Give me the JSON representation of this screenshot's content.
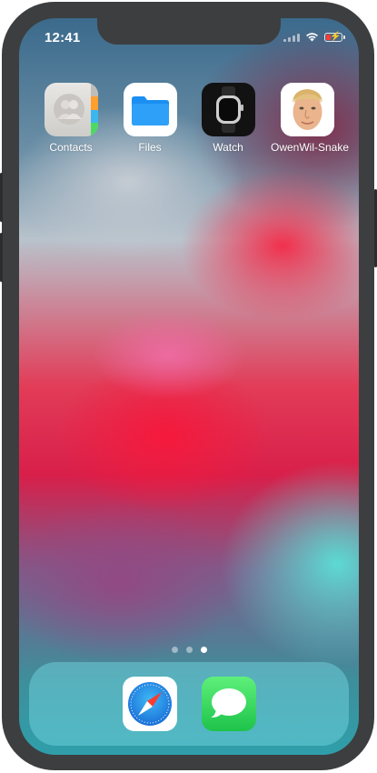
{
  "status_bar": {
    "time": "12:41",
    "battery_level": 0.3,
    "charging": true
  },
  "home_screen": {
    "apps": [
      {
        "label": "Contacts",
        "icon": "contacts-icon"
      },
      {
        "label": "Files",
        "icon": "files-folder-icon"
      },
      {
        "label": "Watch",
        "icon": "apple-watch-icon"
      },
      {
        "label": "OwenWil-Snake",
        "icon": "owen-face-icon"
      }
    ],
    "page_dots": {
      "count": 3,
      "active": 3
    }
  },
  "dock": {
    "apps": [
      {
        "label": "Safari",
        "icon": "safari-compass-icon"
      },
      {
        "label": "Messages",
        "icon": "messages-bubble-icon"
      }
    ]
  },
  "colors": {
    "frame": "#3d3e40",
    "files_blue": "#1b8ff2",
    "messages_green": "#35c95a",
    "battery_red": "#ff3b30"
  }
}
